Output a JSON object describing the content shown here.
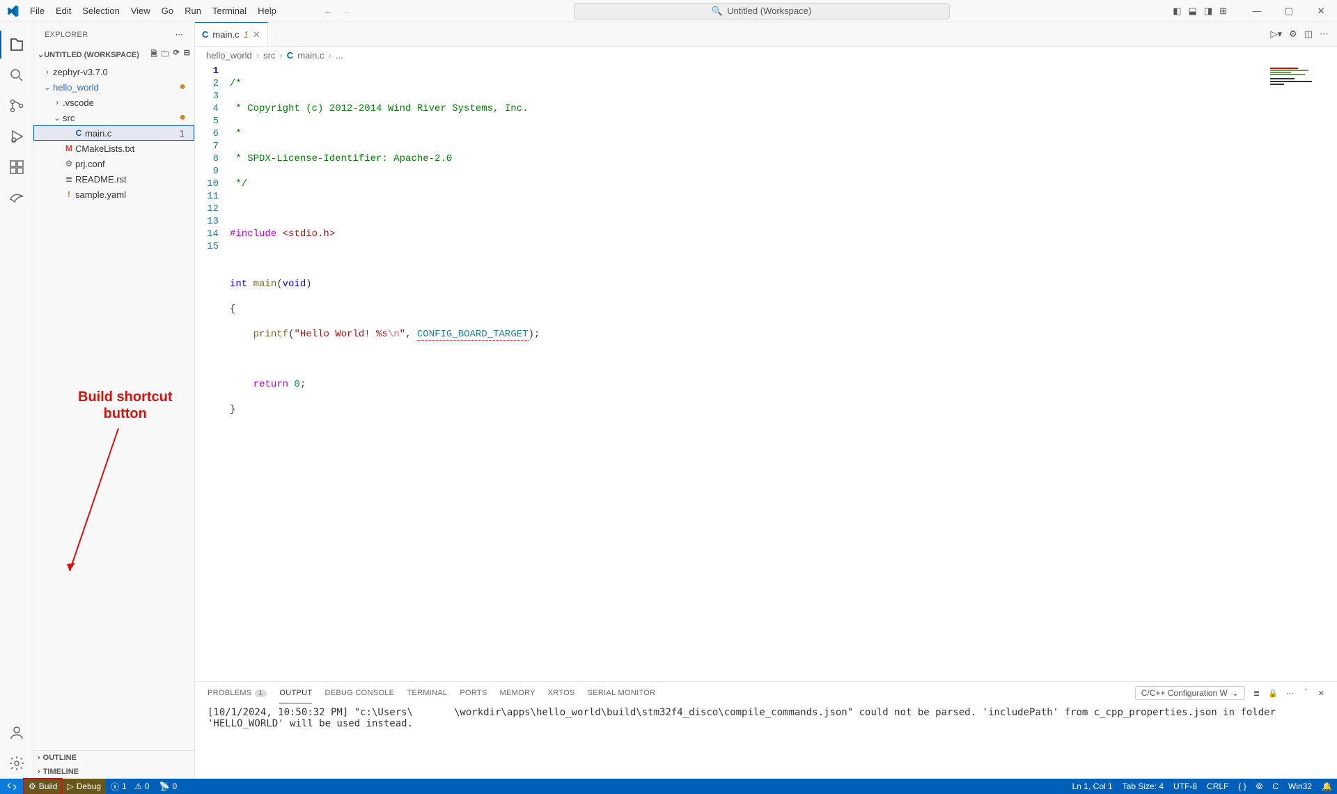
{
  "menu": [
    "File",
    "Edit",
    "Selection",
    "View",
    "Go",
    "Run",
    "Terminal",
    "Help"
  ],
  "search_placeholder": "Untitled (Workspace)",
  "explorer": {
    "title": "EXPLORER",
    "workspace": "UNTITLED (WORKSPACE)",
    "tree": {
      "zephyr": "zephyr-v3.7.0",
      "hello_world": "hello_world",
      "vscode": ".vscode",
      "src": "src",
      "mainc": "main.c",
      "mainc_badge": "1",
      "cmake": "CMakeLists.txt",
      "prj": "prj.conf",
      "readme": "README.rst",
      "sample": "sample.yaml"
    },
    "outline": "OUTLINE",
    "timeline": "TIMELINE"
  },
  "tab": {
    "file": "main.c",
    "mod": "1"
  },
  "breadcrumbs": [
    "hello_world",
    "src",
    "main.c",
    "..."
  ],
  "code": {
    "l1": "/*",
    "l2": " * Copyright (c) 2012-2014 Wind River Systems, Inc.",
    "l3": " *",
    "l4": " * SPDX-License-Identifier: Apache-2.0",
    "l5": " */",
    "inc": "#include",
    "hdr": "<stdio.h>",
    "int": "int",
    "main": "main",
    "void": "void",
    "printf": "printf",
    "str1": "\"Hello World! %s",
    "esc": "\\n",
    "str2": "\"",
    "cfg": "CONFIG_BOARD_TARGET",
    "ret": "return",
    "zero": "0"
  },
  "panel": {
    "tabs": [
      "PROBLEMS",
      "OUTPUT",
      "DEBUG CONSOLE",
      "TERMINAL",
      "PORTS",
      "MEMORY",
      "XRTOS",
      "SERIAL MONITOR"
    ],
    "problems_count": "1",
    "filter": "C/C++ Configuration W",
    "log": "[10/1/2024, 10:50:32 PM] \"c:\\Users\\       \\workdir\\apps\\hello_world\\build\\stm32f4_disco\\compile_commands.json\" could not be parsed. 'includePath' from c_cpp_properties.json in folder 'HELLO_WORLD' will be used instead."
  },
  "status": {
    "build": "Build",
    "debug": "Debug",
    "err": "1",
    "warn": "0",
    "port": "0",
    "ln": "Ln 1, Col 1",
    "tab": "Tab Size: 4",
    "enc": "UTF-8",
    "eol": "CRLF",
    "lang": "C",
    "win": "Win32"
  },
  "annotation": {
    "l1": "Build shortcut",
    "l2": "button"
  }
}
